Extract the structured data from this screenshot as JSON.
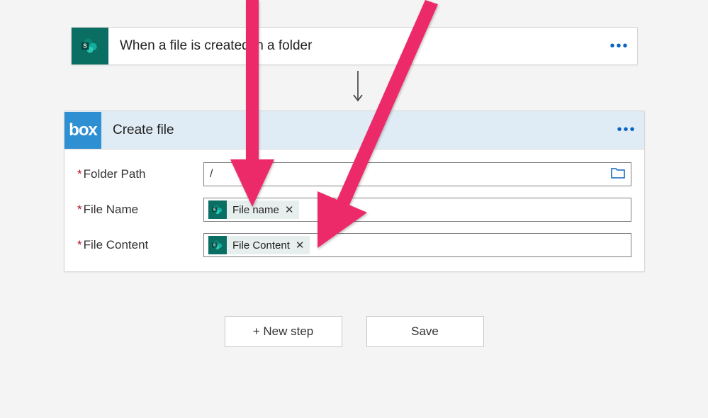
{
  "trigger": {
    "title": "When a file is created in a folder",
    "service": "SharePoint"
  },
  "action": {
    "title": "Create file",
    "service": "Box",
    "fields": {
      "folder_path": {
        "label": "Folder Path",
        "value": "/"
      },
      "file_name": {
        "label": "File Name",
        "token": "File name"
      },
      "file_content": {
        "label": "File Content",
        "token": "File Content"
      }
    }
  },
  "footer": {
    "new_step_label": "+ New step",
    "save_label": "Save"
  }
}
